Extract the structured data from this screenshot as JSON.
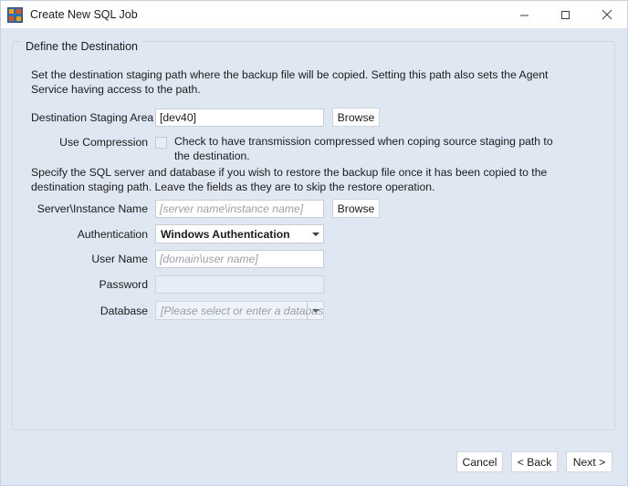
{
  "window": {
    "title": "Create New SQL Job",
    "icon": "sql-job-icon",
    "controls": {
      "minimize": "minimize-icon",
      "maximize": "maximize-icon",
      "close": "close-icon"
    }
  },
  "group": {
    "legend": "Define the Destination"
  },
  "paragraphs": {
    "destination_info": "Set the destination staging path where the backup file will be copied. Setting this path also sets the Agent Service having access to the path.",
    "restore_info": "Specify the SQL server and database if you wish to restore the backup file once it has been copied to the destination staging path. Leave the fields as they are to skip the restore operation."
  },
  "form": {
    "destination_staging_area": {
      "label": "Destination Staging Area",
      "value": "[dev40]",
      "browse_label": "Browse"
    },
    "use_compression": {
      "label": "Use Compression",
      "checked": false,
      "description": "Check to have transmission compressed when coping source staging path to the destination."
    },
    "server_instance_name": {
      "label": "Server\\Instance Name",
      "value": "",
      "placeholder": "[server name\\instance name]",
      "browse_label": "Browse"
    },
    "authentication": {
      "label": "Authentication",
      "value": "Windows Authentication"
    },
    "user_name": {
      "label": "User Name",
      "value": "",
      "placeholder": "[domain\\user name]"
    },
    "password": {
      "label": "Password",
      "value": ""
    },
    "database": {
      "label": "Database",
      "value": "",
      "placeholder": "[Please select or enter a database]"
    }
  },
  "footer": {
    "cancel_label": "Cancel",
    "back_label": "< Back",
    "next_label": "Next >"
  },
  "colors": {
    "dialog_background": "#dfe7f3",
    "titlebar_background": "#ffffff",
    "field_background": "#ffffff",
    "disabled_field_background": "#e7edf6",
    "border": "#cdd6e3",
    "text": "#1b1b1b",
    "placeholder_text": "#9aa0a6"
  }
}
